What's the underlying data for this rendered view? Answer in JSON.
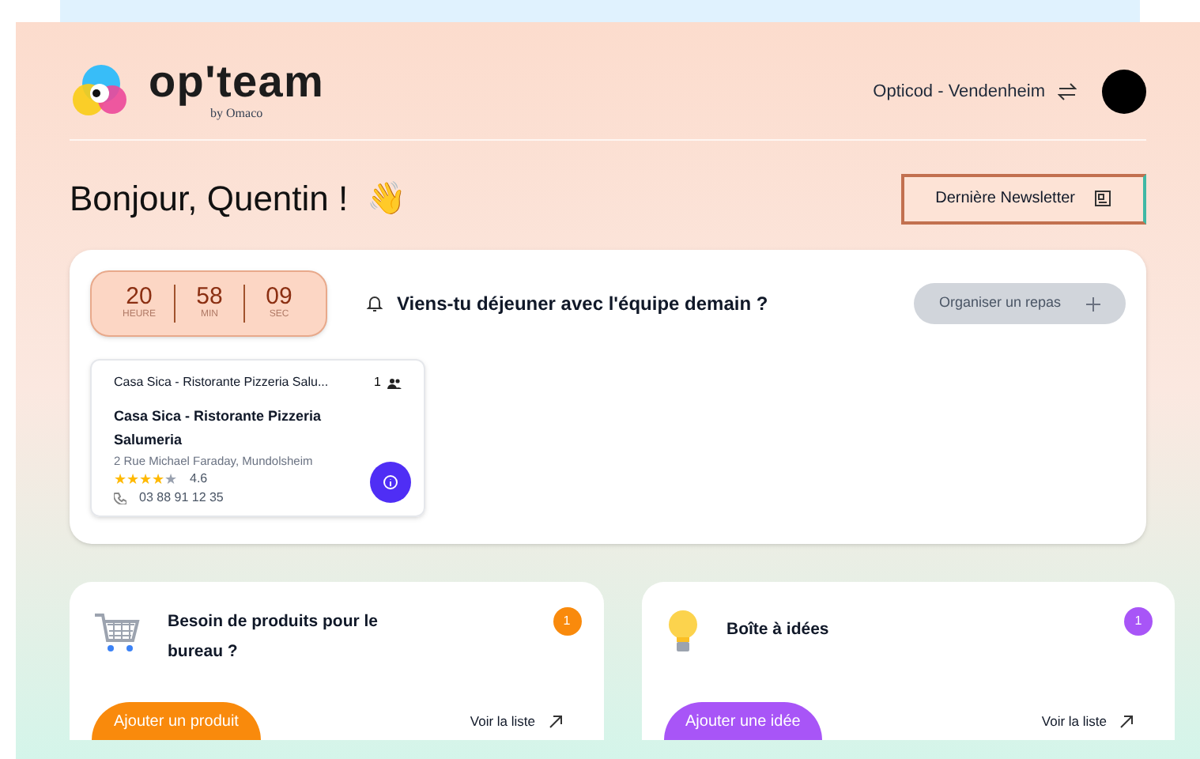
{
  "header": {
    "brand": "op'team",
    "brand_sub": "by Omaco",
    "site": "Opticod - Vendenheim"
  },
  "greeting": {
    "text": "Bonjour, Quentin !",
    "emoji": "👋"
  },
  "newsletter_button": "Dernière Newsletter",
  "lunch": {
    "countdown": [
      {
        "value": "20",
        "unit": "HEURE"
      },
      {
        "value": "58",
        "unit": "MIN"
      },
      {
        "value": "09",
        "unit": "SEC"
      }
    ],
    "question": "Viens-tu déjeuner avec l'équipe demain ?",
    "organize_button": {
      "label": "Organiser un repas",
      "disabled": true
    },
    "restaurants": [
      {
        "header": "Casa Sica - Ristorante Pizzeria Salu...",
        "count": "1",
        "name": "Casa Sica - Ristorante Pizzeria Salumeria",
        "address": "2 Rue Michael Faraday, Mundolsheim",
        "stars": 4,
        "rating": "4.6",
        "phone": "03 88 91 12 35"
      }
    ]
  },
  "cards": [
    {
      "kind": "cart",
      "title": "Besoin de produits pour le bureau ?",
      "badge": "1",
      "color": "#f98a0c",
      "button": "Ajouter un produit",
      "link": "Voir la liste"
    },
    {
      "kind": "idea",
      "title": "Boîte à idées",
      "badge": "1",
      "color": "#a855f7",
      "button": "Ajouter une idée",
      "link": "Voir la liste"
    }
  ]
}
